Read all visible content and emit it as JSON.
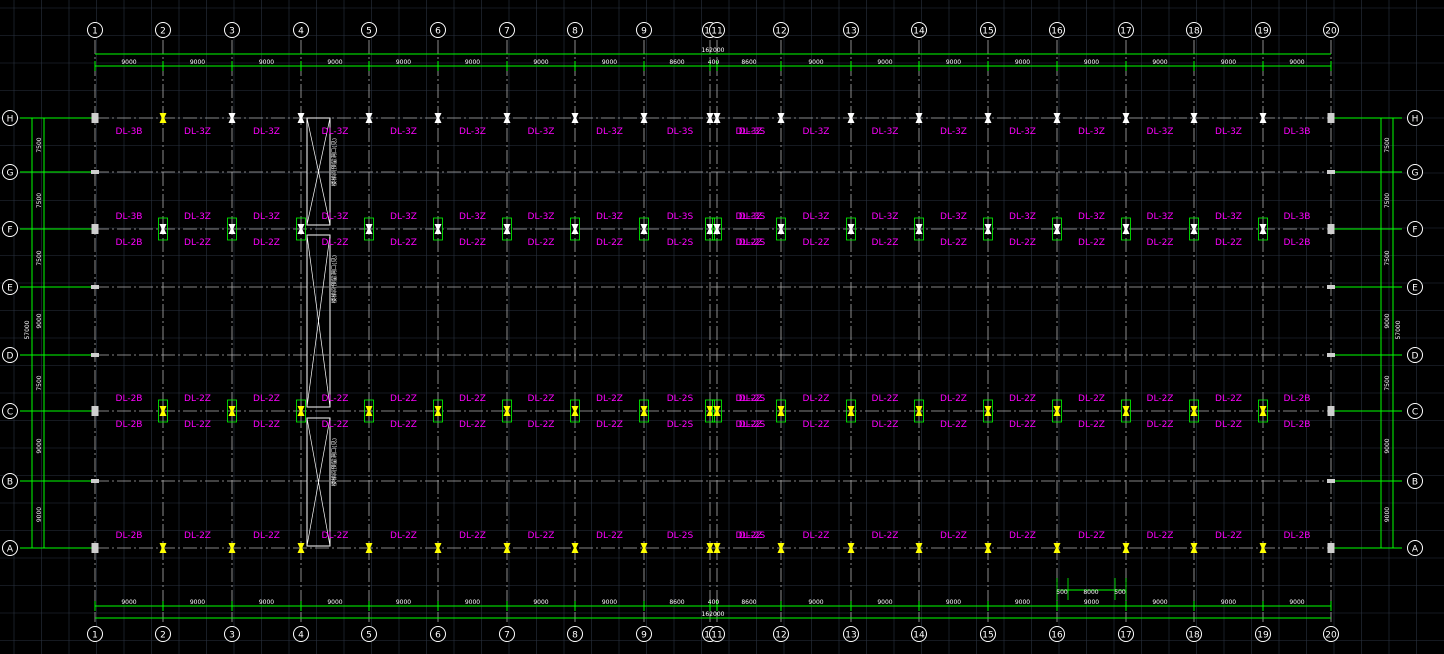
{
  "canvas_bg": "#000000",
  "colors": {
    "grid": "#2a3340",
    "dim": "#00ff00",
    "bubble": "#ffffff",
    "label": "#ff00ff",
    "highlight": "#ffff00",
    "axis": "#b0b0b0"
  },
  "columns": [
    "1",
    "2",
    "3",
    "4",
    "5",
    "6",
    "7",
    "8",
    "9",
    "10",
    "11",
    "12",
    "13",
    "14",
    "15",
    "16",
    "17",
    "18",
    "19",
    "20"
  ],
  "rows": [
    "H",
    "G",
    "F",
    "E",
    "D",
    "C",
    "B",
    "A"
  ],
  "top_spans": [
    "9000",
    "9000",
    "9000",
    "9000",
    "9000",
    "9000",
    "9000",
    "9000",
    "8600",
    "400",
    "8600",
    "9000",
    "9000",
    "9000",
    "9000",
    "9000",
    "9000",
    "9000",
    "9000"
  ],
  "bottom_spans": [
    "9000",
    "9000",
    "9000",
    "9000",
    "9000",
    "9000",
    "9000",
    "9000",
    "8600",
    "400",
    "8600",
    "9000",
    "9000",
    "9000",
    "9000",
    "9000",
    "9000",
    "9000",
    "9000"
  ],
  "total_length": "162000",
  "row_spans": [
    "7500",
    "7500",
    "7500",
    "9000",
    "7500",
    "9000",
    "9000"
  ],
  "total_width": "57000",
  "small_dims": [
    "500",
    "8000",
    "500"
  ],
  "beam_rows": [
    {
      "row": "H",
      "pos": "below",
      "labels": [
        "DL-3B",
        "DL-3Z",
        "DL-3Z",
        "DL-3Z",
        "DL-3Z",
        "DL-3Z",
        "DL-3Z",
        "DL-3Z",
        "DL-3S",
        "DL-3S",
        "DL-3Z",
        "DL-3Z",
        "DL-3Z",
        "DL-3Z",
        "DL-3Z",
        "DL-3Z",
        "DL-3Z",
        "DL-3Z",
        "DL-3B"
      ]
    },
    {
      "row": "F",
      "pos": "above",
      "labels": [
        "DL-3B",
        "DL-3Z",
        "DL-3Z",
        "DL-3Z",
        "DL-3Z",
        "DL-3Z",
        "DL-3Z",
        "DL-3Z",
        "DL-3S",
        "DL-3S",
        "DL-3Z",
        "DL-3Z",
        "DL-3Z",
        "DL-3Z",
        "DL-3Z",
        "DL-3Z",
        "DL-3Z",
        "DL-3Z",
        "DL-3B"
      ]
    },
    {
      "row": "F",
      "pos": "below",
      "labels": [
        "DL-2B",
        "DL-2Z",
        "DL-2Z",
        "DL-2Z",
        "DL-2Z",
        "DL-2Z",
        "DL-2Z",
        "DL-2Z",
        "DL-2S",
        "DL-2S",
        "DL-2Z",
        "DL-2Z",
        "DL-2Z",
        "DL-2Z",
        "DL-2Z",
        "DL-2Z",
        "DL-2Z",
        "DL-2Z",
        "DL-2B"
      ]
    },
    {
      "row": "C",
      "pos": "above",
      "labels": [
        "DL-2B",
        "DL-2Z",
        "DL-2Z",
        "DL-2Z",
        "DL-2Z",
        "DL-2Z",
        "DL-2Z",
        "DL-2Z",
        "DL-2S",
        "DL-2S",
        "DL-2Z",
        "DL-2Z",
        "DL-2Z",
        "DL-2Z",
        "DL-2Z",
        "DL-2Z",
        "DL-2Z",
        "DL-2Z",
        "DL-2B"
      ]
    },
    {
      "row": "C",
      "pos": "below",
      "labels": [
        "DL-2B",
        "DL-2Z",
        "DL-2Z",
        "DL-2Z",
        "DL-2Z",
        "DL-2Z",
        "DL-2Z",
        "DL-2Z",
        "DL-2S",
        "DL-2S",
        "DL-2Z",
        "DL-2Z",
        "DL-2Z",
        "DL-2Z",
        "DL-2Z",
        "DL-2Z",
        "DL-2Z",
        "DL-2Z",
        "DL-2B"
      ]
    },
    {
      "row": "A",
      "pos": "above",
      "labels": [
        "DL-2B",
        "DL-2Z",
        "DL-2Z",
        "DL-2Z",
        "DL-2Z",
        "DL-2Z",
        "DL-2Z",
        "DL-2Z",
        "DL-2S",
        "DL-2S",
        "DL-2Z",
        "DL-2Z",
        "DL-2Z",
        "DL-2Z",
        "DL-2Z",
        "DL-2Z",
        "DL-2Z",
        "DL-2Z",
        "DL-2B"
      ]
    }
  ],
  "opening_notes": [
    "楼梯间预留洞口(见)",
    "楼梯间预留洞口(见)",
    "楼梯间预留洞口(见)"
  ]
}
